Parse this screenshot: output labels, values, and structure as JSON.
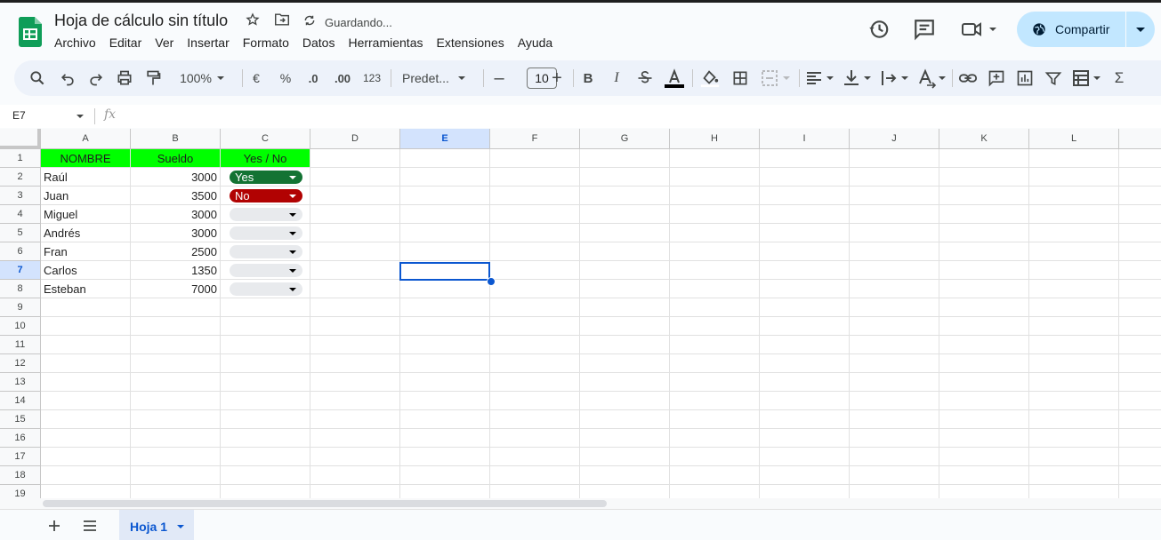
{
  "doc": {
    "title": "Hoja de cálculo sin título",
    "status": "Guardando...",
    "menu": [
      "Archivo",
      "Editar",
      "Ver",
      "Insertar",
      "Formato",
      "Datos",
      "Herramientas",
      "Extensiones",
      "Ayuda"
    ],
    "share_label": "Compartir"
  },
  "toolbar": {
    "zoom": "100%",
    "currency": "€",
    "percent": "%",
    "dec_decrease": ".0",
    "dec_increase": ".00",
    "format_123": "123",
    "font": "Predet...",
    "font_size": "10",
    "bold": "B",
    "italic": "I",
    "sigma": "Σ"
  },
  "formula_bar": {
    "cell_ref": "E7",
    "fx": "fx"
  },
  "columns": [
    "A",
    "B",
    "C",
    "D",
    "E",
    "F",
    "G",
    "H",
    "I",
    "J",
    "K",
    "L"
  ],
  "rows": [
    "1",
    "2",
    "3",
    "4",
    "5",
    "6",
    "7",
    "8",
    "9",
    "10",
    "11",
    "12",
    "13",
    "14",
    "15",
    "16",
    "17",
    "18",
    "19"
  ],
  "table": {
    "headers": [
      "NOMBRE",
      "Sueldo",
      "Yes / No"
    ],
    "data": [
      {
        "name": "Raúl",
        "salary": "3000",
        "choice": "Yes"
      },
      {
        "name": "Juan",
        "salary": "3500",
        "choice": "No"
      },
      {
        "name": "Miguel",
        "salary": "3000",
        "choice": ""
      },
      {
        "name": "Andrés",
        "salary": "3000",
        "choice": ""
      },
      {
        "name": "Fran",
        "salary": "2500",
        "choice": ""
      },
      {
        "name": "Carlos",
        "salary": "1350",
        "choice": ""
      },
      {
        "name": "Esteban",
        "salary": "7000",
        "choice": ""
      }
    ]
  },
  "colors": {
    "header_fill": "#00ff00",
    "chip_yes": "#137333",
    "chip_no": "#b10202",
    "chip_empty": "#e8eaed",
    "selection": "#0b57d0"
  },
  "sheets": {
    "active": "Hoja 1"
  }
}
